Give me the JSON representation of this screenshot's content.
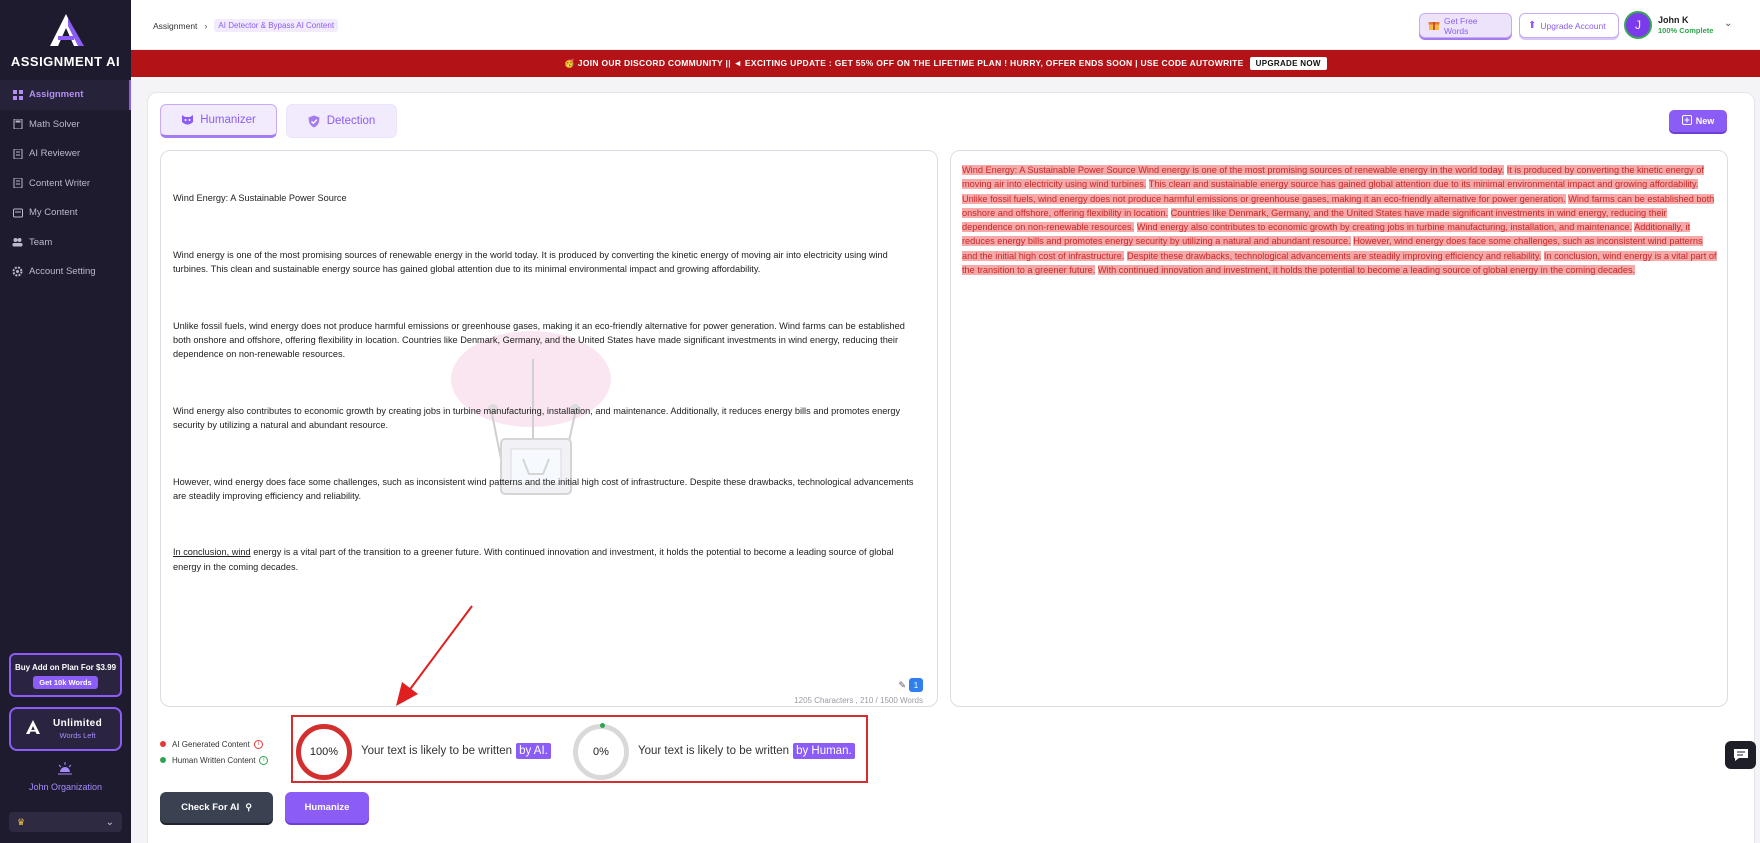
{
  "app": {
    "logo_text": "ASSIGNMENT AI"
  },
  "sidebar": {
    "items": [
      {
        "label": "Assignment",
        "icon": "grid-icon",
        "active": true
      },
      {
        "label": "Math Solver",
        "icon": "calculator-icon"
      },
      {
        "label": "AI Reviewer",
        "icon": "document-icon"
      },
      {
        "label": "Content Writer",
        "icon": "document-icon"
      },
      {
        "label": "My Content",
        "icon": "folder-icon"
      },
      {
        "label": "Team",
        "icon": "team-icon"
      },
      {
        "label": "Account Setting",
        "icon": "gear-icon"
      }
    ],
    "promo": {
      "title": "Buy Add on Plan For $3.99",
      "button": "Get 10k Words"
    },
    "plan": {
      "title": "Unlimited",
      "subtitle": "Words Left"
    },
    "organization": {
      "name": "John Organization",
      "selected_icon": "crown-icon"
    }
  },
  "header": {
    "breadcrumb": [
      "Assignment",
      "AI Detector & Bypass AI Content"
    ],
    "free_words_label": "Get Free Words",
    "upgrade_label": "Upgrade Account",
    "user": {
      "initial": "J",
      "name": "John K",
      "status": "100% Complete"
    }
  },
  "banner": {
    "text": "🥳 JOIN OUR DISCORD COMMUNITY || ◄ EXCITING UPDATE : GET 55% OFF ON THE LIFETIME PLAN ! HURRY, OFFER ENDS SOON | USE CODE AUTOWRITE",
    "button": "UPGRADE NOW"
  },
  "tabs": [
    {
      "label": "Humanizer",
      "active": true
    },
    {
      "label": "Detection",
      "active": false
    }
  ],
  "new_button": "New",
  "input": {
    "title": "Wind Energy: A Sustainable Power Source",
    "p1": "Wind energy is one of the most promising sources of renewable energy in the world today. It is produced by converting the kinetic energy of moving air into electricity using wind turbines. This clean and sustainable energy source has gained global attention due to its minimal environmental impact and growing affordability.",
    "p2": "Unlike fossil fuels, wind energy does not produce harmful emissions or greenhouse gases, making it an eco-friendly alternative for power generation. Wind farms can be established both onshore and offshore, offering flexibility in location. Countries like Denmark, Germany, and the United States have made significant investments in wind energy, reducing their dependence on non-renewable resources.",
    "p3": "Wind energy also contributes to economic growth by creating jobs in turbine manufacturing, installation, and maintenance. Additionally, it reduces energy bills and promotes energy security by utilizing a natural and abundant resource.",
    "p4": "However, wind energy does face some challenges, such as inconsistent wind patterns and the initial high cost of infrastructure. Despite these drawbacks, technological advancements are steadily improving efficiency and reliability.",
    "p5_underlined": "In conclusion, wind",
    "p5_rest": " energy is a vital part of the transition to a greener future. With continued innovation and investment, it holds the potential to become a leading source of global energy in the coming decades.",
    "badge_count": "1",
    "counter": "1205 Characters , 210 / 1500 Words"
  },
  "output": {
    "sentences": [
      "Wind Energy: A Sustainable Power Source Wind energy is one of the most promising sources of renewable energy in the world today.",
      "It is produced by converting the kinetic energy of moving air into electricity using wind turbines.",
      "This clean and sustainable energy source has gained global attention due to its minimal environmental impact and growing affordability.",
      "Unlike fossil fuels, wind energy does not produce harmful emissions or greenhouse gases, making it an eco-friendly alternative for power generation.",
      "Wind farms can be established both onshore and offshore, offering flexibility in location.",
      "Countries like Denmark, Germany, and the United States have made significant investments in wind energy, reducing their dependence on non-renewable resources.",
      "Wind energy also contributes to economic growth by creating jobs in turbine manufacturing, installation, and maintenance.",
      "Additionally, it reduces energy bills and promotes energy security by utilizing a natural and abundant resource.",
      "However, wind energy does face some challenges, such as inconsistent wind patterns and the initial high cost of infrastructure.",
      "Despite these drawbacks, technological advancements are steadily improving efficiency and reliability.",
      "In conclusion, wind energy is a vital part of the transition to a greener future.",
      "With continued innovation and investment, it holds the potential to become a leading source of global energy in the coming decades."
    ]
  },
  "legend": {
    "ai_label": "AI Generated Content",
    "human_label": "Human Written Content",
    "ai_color": "#e53935",
    "human_color": "#2ea44f"
  },
  "results": {
    "ai_percent": "100%",
    "ai_text": "Your text is likely to be written",
    "ai_pill": "by AI.",
    "human_percent": "0%",
    "human_text": "Your text is likely to be written",
    "human_pill": "by Human."
  },
  "buttons": {
    "check": "Check For AI",
    "humanize": "Humanize"
  },
  "colors": {
    "accent": "#8b5cf6",
    "sidebar": "#1e1b2e",
    "banner": "#b31217",
    "ai_highlight": "#f7a9a9"
  }
}
